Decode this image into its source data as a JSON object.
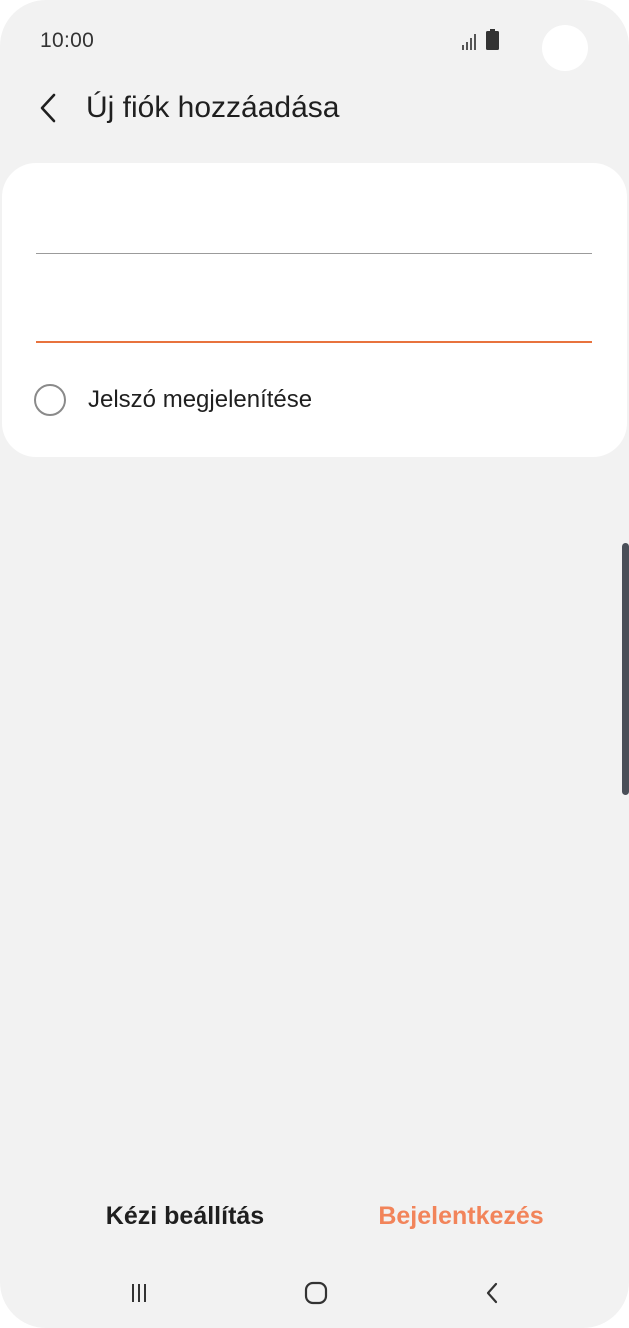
{
  "status_bar": {
    "time": "10:00"
  },
  "header": {
    "title": "Új fiók hozzáadása",
    "back_icon": "chevron-left-icon"
  },
  "form": {
    "email_value": "",
    "password_value": "",
    "show_password_label": "Jelszó megjelenítése",
    "show_password_checked": false
  },
  "actions": {
    "manual_setup_label": "Kézi beállítás",
    "login_label": "Bejelentkezés"
  },
  "colors": {
    "accent": "#e8733e",
    "login_text": "#f2845a",
    "background": "#f2f2f2",
    "card": "#ffffff"
  },
  "nav_bar": {
    "recents_icon": "recents-icon",
    "home_icon": "home-icon",
    "back_icon": "back-icon"
  }
}
